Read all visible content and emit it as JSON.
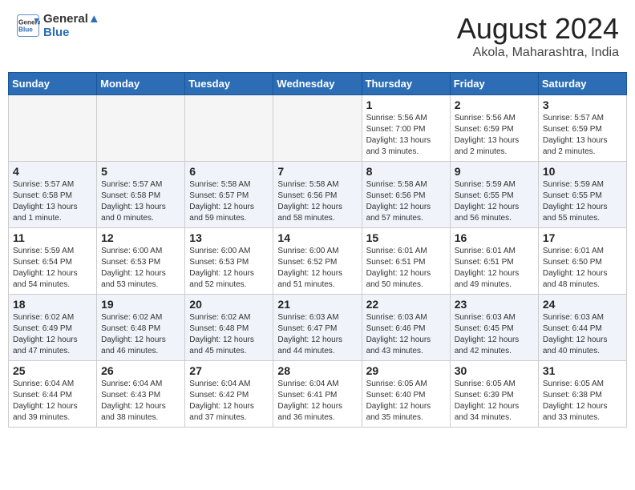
{
  "header": {
    "logo_line1": "General",
    "logo_line2": "Blue",
    "main_title": "August 2024",
    "sub_title": "Akola, Maharashtra, India"
  },
  "days_of_week": [
    "Sunday",
    "Monday",
    "Tuesday",
    "Wednesday",
    "Thursday",
    "Friday",
    "Saturday"
  ],
  "weeks": [
    [
      {
        "day": "",
        "info": ""
      },
      {
        "day": "",
        "info": ""
      },
      {
        "day": "",
        "info": ""
      },
      {
        "day": "",
        "info": ""
      },
      {
        "day": "1",
        "info": "Sunrise: 5:56 AM\nSunset: 7:00 PM\nDaylight: 13 hours\nand 3 minutes."
      },
      {
        "day": "2",
        "info": "Sunrise: 5:56 AM\nSunset: 6:59 PM\nDaylight: 13 hours\nand 2 minutes."
      },
      {
        "day": "3",
        "info": "Sunrise: 5:57 AM\nSunset: 6:59 PM\nDaylight: 13 hours\nand 2 minutes."
      }
    ],
    [
      {
        "day": "4",
        "info": "Sunrise: 5:57 AM\nSunset: 6:58 PM\nDaylight: 13 hours\nand 1 minute."
      },
      {
        "day": "5",
        "info": "Sunrise: 5:57 AM\nSunset: 6:58 PM\nDaylight: 13 hours\nand 0 minutes."
      },
      {
        "day": "6",
        "info": "Sunrise: 5:58 AM\nSunset: 6:57 PM\nDaylight: 12 hours\nand 59 minutes."
      },
      {
        "day": "7",
        "info": "Sunrise: 5:58 AM\nSunset: 6:56 PM\nDaylight: 12 hours\nand 58 minutes."
      },
      {
        "day": "8",
        "info": "Sunrise: 5:58 AM\nSunset: 6:56 PM\nDaylight: 12 hours\nand 57 minutes."
      },
      {
        "day": "9",
        "info": "Sunrise: 5:59 AM\nSunset: 6:55 PM\nDaylight: 12 hours\nand 56 minutes."
      },
      {
        "day": "10",
        "info": "Sunrise: 5:59 AM\nSunset: 6:55 PM\nDaylight: 12 hours\nand 55 minutes."
      }
    ],
    [
      {
        "day": "11",
        "info": "Sunrise: 5:59 AM\nSunset: 6:54 PM\nDaylight: 12 hours\nand 54 minutes."
      },
      {
        "day": "12",
        "info": "Sunrise: 6:00 AM\nSunset: 6:53 PM\nDaylight: 12 hours\nand 53 minutes."
      },
      {
        "day": "13",
        "info": "Sunrise: 6:00 AM\nSunset: 6:53 PM\nDaylight: 12 hours\nand 52 minutes."
      },
      {
        "day": "14",
        "info": "Sunrise: 6:00 AM\nSunset: 6:52 PM\nDaylight: 12 hours\nand 51 minutes."
      },
      {
        "day": "15",
        "info": "Sunrise: 6:01 AM\nSunset: 6:51 PM\nDaylight: 12 hours\nand 50 minutes."
      },
      {
        "day": "16",
        "info": "Sunrise: 6:01 AM\nSunset: 6:51 PM\nDaylight: 12 hours\nand 49 minutes."
      },
      {
        "day": "17",
        "info": "Sunrise: 6:01 AM\nSunset: 6:50 PM\nDaylight: 12 hours\nand 48 minutes."
      }
    ],
    [
      {
        "day": "18",
        "info": "Sunrise: 6:02 AM\nSunset: 6:49 PM\nDaylight: 12 hours\nand 47 minutes."
      },
      {
        "day": "19",
        "info": "Sunrise: 6:02 AM\nSunset: 6:48 PM\nDaylight: 12 hours\nand 46 minutes."
      },
      {
        "day": "20",
        "info": "Sunrise: 6:02 AM\nSunset: 6:48 PM\nDaylight: 12 hours\nand 45 minutes."
      },
      {
        "day": "21",
        "info": "Sunrise: 6:03 AM\nSunset: 6:47 PM\nDaylight: 12 hours\nand 44 minutes."
      },
      {
        "day": "22",
        "info": "Sunrise: 6:03 AM\nSunset: 6:46 PM\nDaylight: 12 hours\nand 43 minutes."
      },
      {
        "day": "23",
        "info": "Sunrise: 6:03 AM\nSunset: 6:45 PM\nDaylight: 12 hours\nand 42 minutes."
      },
      {
        "day": "24",
        "info": "Sunrise: 6:03 AM\nSunset: 6:44 PM\nDaylight: 12 hours\nand 40 minutes."
      }
    ],
    [
      {
        "day": "25",
        "info": "Sunrise: 6:04 AM\nSunset: 6:44 PM\nDaylight: 12 hours\nand 39 minutes."
      },
      {
        "day": "26",
        "info": "Sunrise: 6:04 AM\nSunset: 6:43 PM\nDaylight: 12 hours\nand 38 minutes."
      },
      {
        "day": "27",
        "info": "Sunrise: 6:04 AM\nSunset: 6:42 PM\nDaylight: 12 hours\nand 37 minutes."
      },
      {
        "day": "28",
        "info": "Sunrise: 6:04 AM\nSunset: 6:41 PM\nDaylight: 12 hours\nand 36 minutes."
      },
      {
        "day": "29",
        "info": "Sunrise: 6:05 AM\nSunset: 6:40 PM\nDaylight: 12 hours\nand 35 minutes."
      },
      {
        "day": "30",
        "info": "Sunrise: 6:05 AM\nSunset: 6:39 PM\nDaylight: 12 hours\nand 34 minutes."
      },
      {
        "day": "31",
        "info": "Sunrise: 6:05 AM\nSunset: 6:38 PM\nDaylight: 12 hours\nand 33 minutes."
      }
    ]
  ]
}
